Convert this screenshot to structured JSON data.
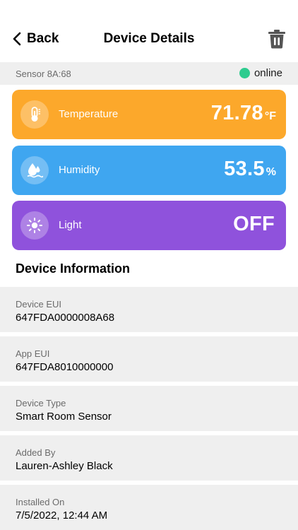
{
  "header": {
    "back_label": "Back",
    "title": "Device Details",
    "back_icon": "chevron-left-icon",
    "delete_icon": "trash-icon"
  },
  "status_bar": {
    "sensor_name": "Sensor 8A:68",
    "status": "online",
    "status_color": "#2ecc8f"
  },
  "readings": [
    {
      "label": "Temperature",
      "value": "71.78",
      "unit": "°F",
      "icon": "thermometer-icon",
      "color": "#fca82b"
    },
    {
      "label": "Humidity",
      "value": "53.5",
      "unit": "%",
      "icon": "water-drop-icon",
      "color": "#3fa6f0"
    },
    {
      "label": "Light",
      "value": "OFF",
      "unit": "",
      "icon": "sun-icon",
      "color": "#8f52dc"
    }
  ],
  "device_info": {
    "title": "Device Information",
    "rows": [
      {
        "label": "Device EUI",
        "value": "647FDA0000008A68"
      },
      {
        "label": "App EUI",
        "value": "647FDA8010000000"
      },
      {
        "label": "Device Type",
        "value": "Smart Room Sensor"
      },
      {
        "label": "Added By",
        "value": "Lauren-Ashley Black"
      },
      {
        "label": "Installed On",
        "value": "7/5/2022, 12:44 AM"
      }
    ]
  }
}
